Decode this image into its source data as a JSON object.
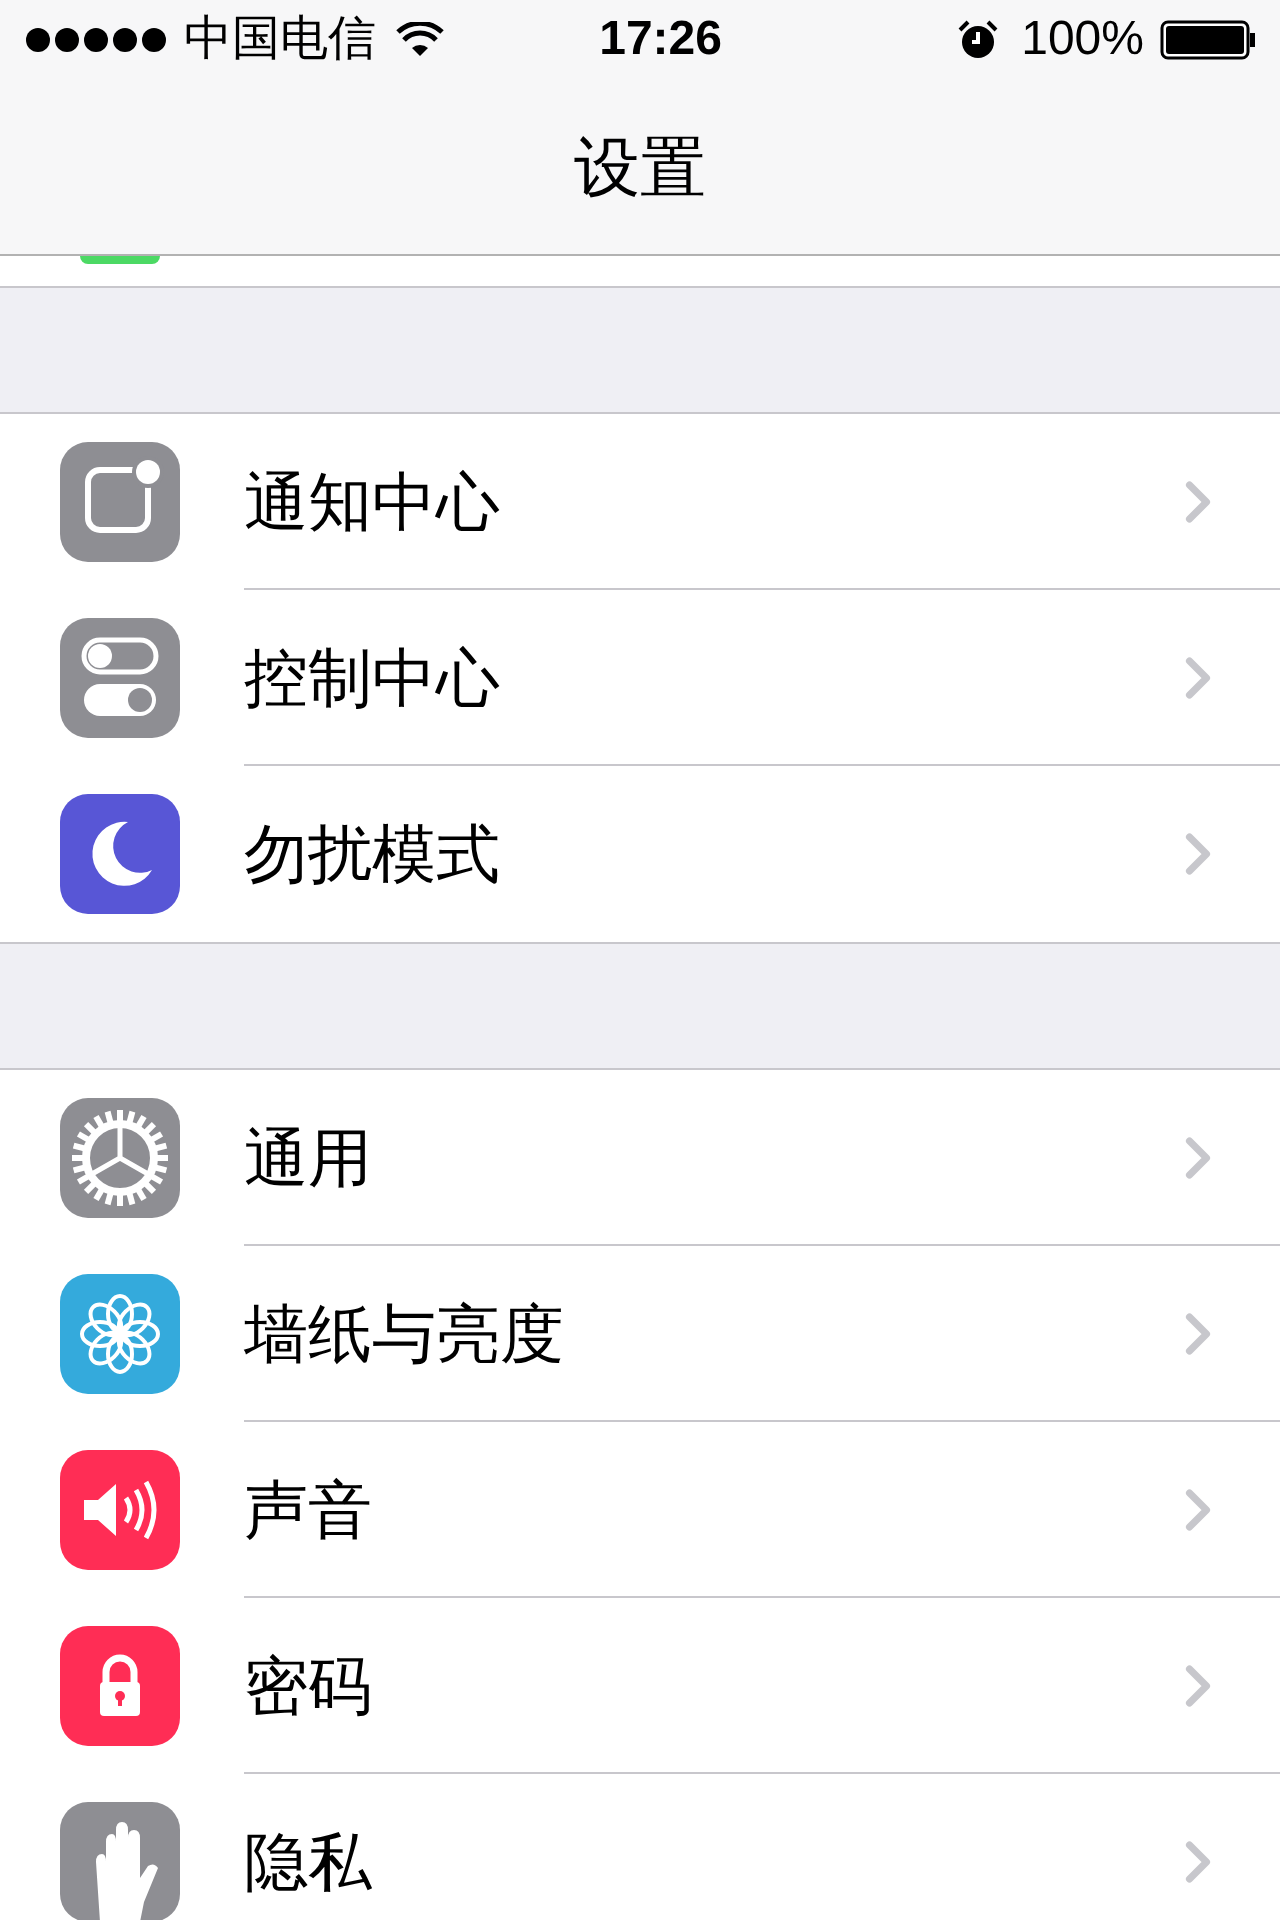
{
  "status_bar": {
    "carrier": "中国电信",
    "time": "17:26",
    "battery": "100%"
  },
  "nav_bar": {
    "title": "设置"
  },
  "sections": [
    {
      "items": [
        {
          "kind": "notifications",
          "label": "通知中心"
        },
        {
          "kind": "controls",
          "label": "控制中心"
        },
        {
          "kind": "moon",
          "label": "勿扰模式"
        }
      ]
    },
    {
      "items": [
        {
          "kind": "gear",
          "label": "通用"
        },
        {
          "kind": "flower",
          "label": "墙纸与亮度"
        },
        {
          "kind": "speaker",
          "label": "声音"
        },
        {
          "kind": "lock",
          "label": "密码"
        },
        {
          "kind": "hand",
          "label": "隐私"
        }
      ]
    }
  ]
}
